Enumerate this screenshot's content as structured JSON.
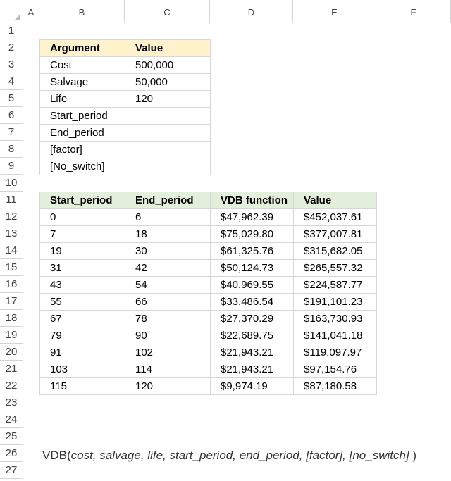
{
  "columns": [
    "A",
    "B",
    "C",
    "D",
    "E",
    "F"
  ],
  "rows": [
    "1",
    "2",
    "3",
    "4",
    "5",
    "6",
    "7",
    "8",
    "9",
    "10",
    "11",
    "12",
    "13",
    "14",
    "15",
    "16",
    "17",
    "18",
    "19",
    "20",
    "21",
    "22",
    "23",
    "24",
    "25",
    "26",
    "27"
  ],
  "args_table": {
    "header": [
      "Argument",
      "Value"
    ],
    "rows": [
      [
        "Cost",
        "500,000"
      ],
      [
        "Salvage",
        "50,000"
      ],
      [
        "Life",
        "120"
      ],
      [
        "Start_period",
        ""
      ],
      [
        "End_period",
        ""
      ],
      [
        "[factor]",
        ""
      ],
      [
        "[No_switch]",
        ""
      ]
    ]
  },
  "vdb_table": {
    "header": [
      "Start_period",
      "End_period",
      "VDB function",
      "Value"
    ],
    "rows": [
      [
        "0",
        "6",
        "$47,962.39",
        "$452,037.61"
      ],
      [
        "7",
        "18",
        "$75,029.80",
        "$377,007.81"
      ],
      [
        "19",
        "30",
        "$61,325.76",
        "$315,682.05"
      ],
      [
        "31",
        "42",
        "$50,124.73",
        "$265,557.32"
      ],
      [
        "43",
        "54",
        "$40,969.55",
        "$224,587.77"
      ],
      [
        "55",
        "66",
        "$33,486.54",
        "$191,101.23"
      ],
      [
        "67",
        "78",
        "$27,370.29",
        "$163,730.93"
      ],
      [
        "79",
        "90",
        "$22,689.75",
        "$141,041.18"
      ],
      [
        "91",
        "102",
        "$21,943.21",
        "$119,097.97"
      ],
      [
        "103",
        "114",
        "$21,943.21",
        "$97,154.76"
      ],
      [
        "115",
        "120",
        "$9,974.19",
        "$87,180.58"
      ]
    ]
  },
  "formula": {
    "fn": "VDB(",
    "args": "cost, salvage, life, start_period, end_period, [factor], [no_switch]",
    "close": " )"
  }
}
